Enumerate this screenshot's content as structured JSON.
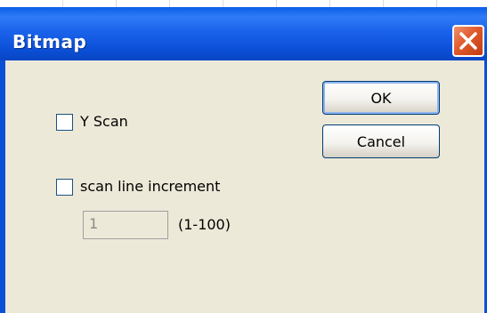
{
  "window": {
    "title": "Bitmap",
    "close_icon": "close-icon"
  },
  "options": {
    "y_scan": {
      "label": "Y Scan",
      "checked": false
    },
    "scan_line_increment": {
      "label": "scan line increment",
      "checked": false
    },
    "increment_value": "1",
    "increment_range": "(1-100)"
  },
  "buttons": {
    "ok_label": "OK",
    "cancel_label": "Cancel"
  },
  "colors": {
    "titlebar": "#0b4fd6",
    "close": "#e05a2c",
    "dialog_face": "#ece9d8"
  }
}
